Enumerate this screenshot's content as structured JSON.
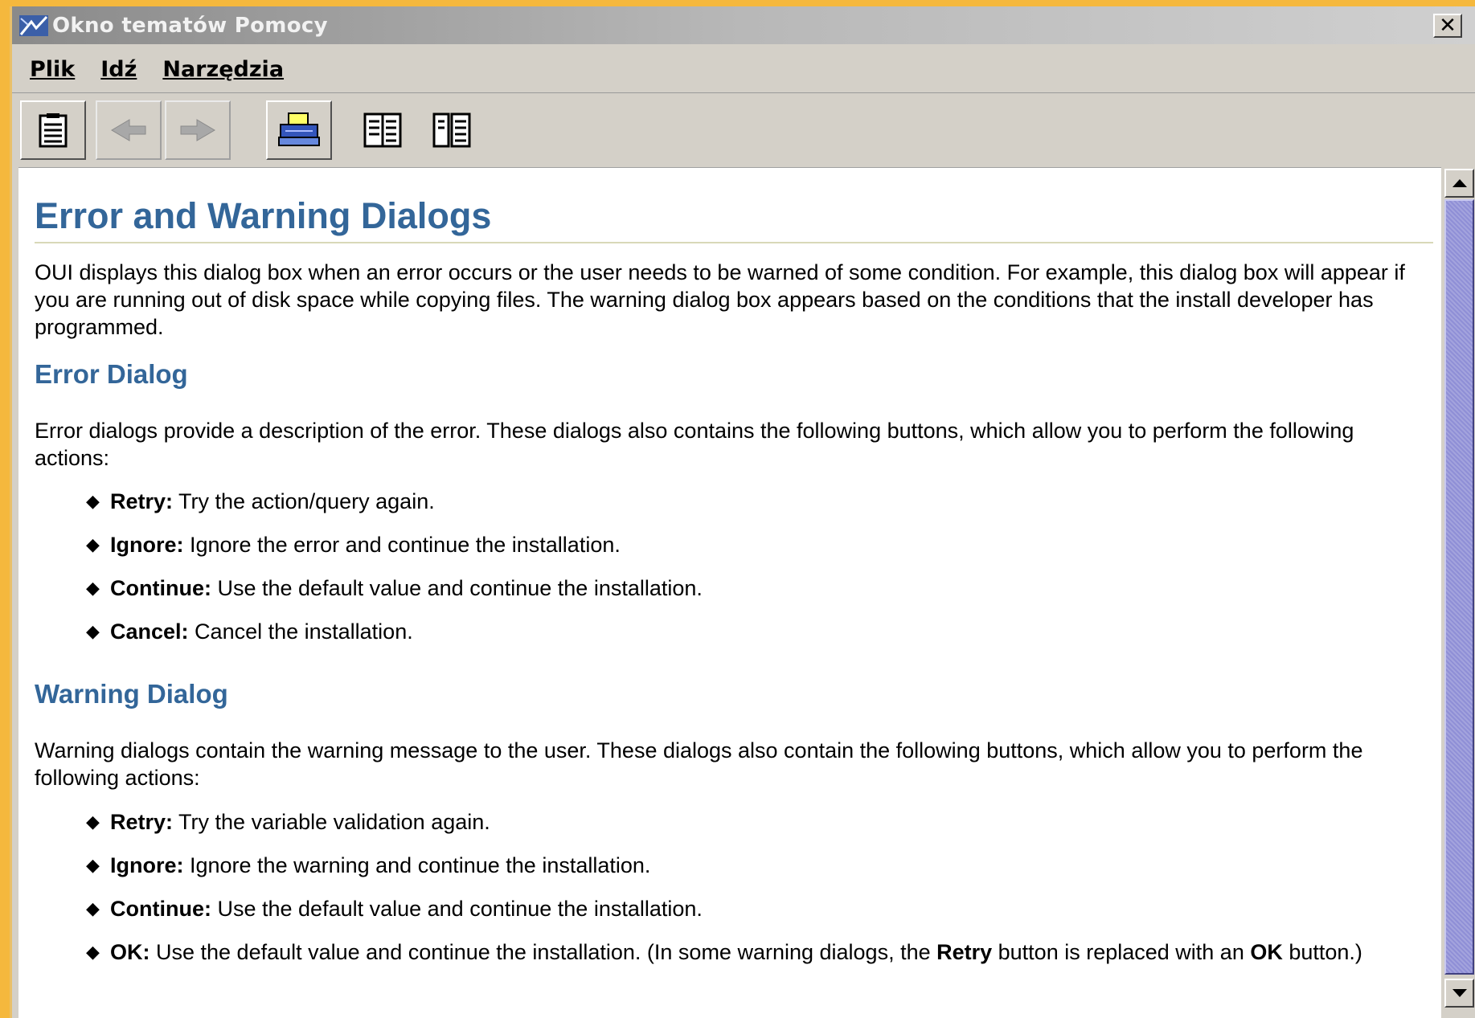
{
  "window": {
    "title": "Okno tematów Pomocy",
    "close_label": "✕"
  },
  "menu": {
    "items": [
      {
        "label": "Plik"
      },
      {
        "label": "Idź"
      },
      {
        "label": "Narzędzia"
      }
    ]
  },
  "toolbar": {
    "icons": [
      "contents-icon",
      "back-arrow-icon",
      "forward-arrow-icon",
      "print-icon",
      "split-view-icon",
      "dual-pane-icon"
    ]
  },
  "doc": {
    "title": "Error and Warning Dialogs",
    "intro": "OUI displays this dialog box when an error occurs or the user needs to be warned of some condition. For example, this dialog box will appear if you are running out of disk space while copying files. The warning dialog box appears based on the conditions that the install developer has programmed.",
    "error_heading": "Error Dialog",
    "error_intro": "Error dialogs provide a description of the error. These dialogs also contains the following buttons, which allow you to perform the following actions:",
    "error_items": [
      {
        "term": "Retry:",
        "text": " Try the action/query again."
      },
      {
        "term": "Ignore:",
        "text": " Ignore the error and continue the installation."
      },
      {
        "term": "Continue:",
        "text": " Use the default value and continue the installation."
      },
      {
        "term": "Cancel:",
        "text": " Cancel the installation."
      }
    ],
    "warning_heading": "Warning Dialog",
    "warning_intro": "Warning dialogs contain the warning message to the user. These dialogs also contain the following buttons, which allow you to perform the following actions:",
    "warning_items": [
      {
        "term": "Retry:",
        "text": " Try the variable validation again."
      },
      {
        "term": "Ignore:",
        "text": " Ignore the warning and continue the installation."
      },
      {
        "term": "Continue:",
        "text": " Use the default value and continue the installation."
      }
    ],
    "ok_item": {
      "term": "OK:",
      "text1": " Use the default value and continue the installation. (In some warning dialogs, the ",
      "bold1": "Retry",
      "text2": " button is replaced with an ",
      "bold2": "OK",
      "text3": " button.)"
    }
  },
  "colors": {
    "heading": "#336699",
    "scroll_thumb": "#8f8fd6",
    "desktop": "#f5b83d"
  }
}
